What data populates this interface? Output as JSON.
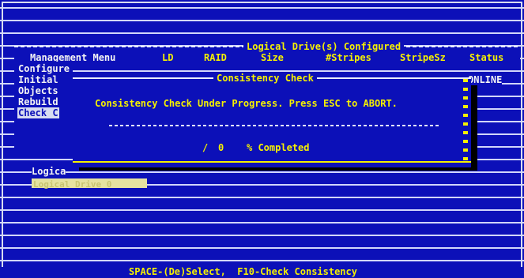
{
  "table": {
    "title": "Logical Drive(s) Configured",
    "columns": [
      "LD",
      "RAID",
      "Size",
      "#Stripes",
      "StripeSz",
      "Status"
    ],
    "status_value": "ONLINE"
  },
  "menu": {
    "title": "Management Menu",
    "items": [
      {
        "label": "Configure"
      },
      {
        "label": "Initial"
      },
      {
        "label": "Objects"
      },
      {
        "label": "Rebuild"
      },
      {
        "label": "Check C"
      }
    ]
  },
  "dialog": {
    "title": "Consistency Check",
    "message": "Consistency Check Under Progress. Press ESC to ABORT.",
    "progress_value": "0",
    "progress_label": "% Completed"
  },
  "logical": {
    "heading": "Logica",
    "selected_item": "Logical Drive 0"
  },
  "footer": {
    "hint": "SPACE-(De)Select,  F10-Check Consistency"
  },
  "colors": {
    "background": "#0c10b8",
    "text_white": "#f4f4f4",
    "text_yellow": "#f5f000",
    "highlight": "#e6e2a0"
  }
}
